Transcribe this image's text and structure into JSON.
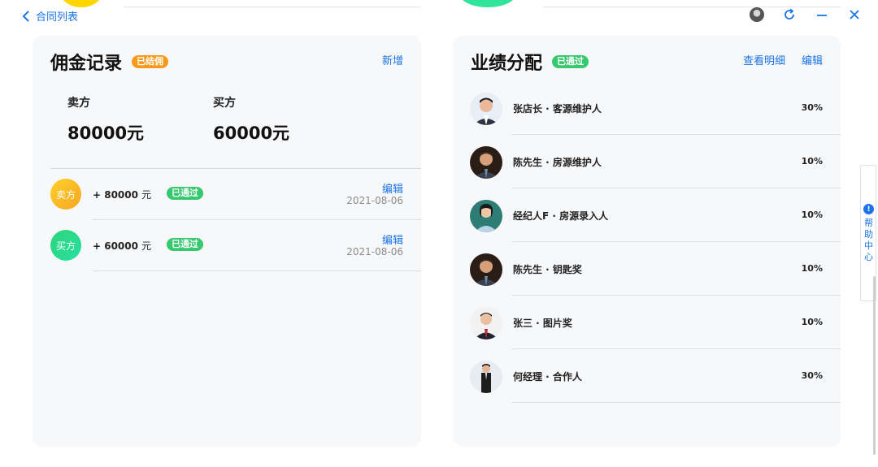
{
  "topbar": {
    "back_label": "合同列表"
  },
  "commission": {
    "title": "佣金记录",
    "status_badge": "已结佣",
    "add_label": "新增",
    "seller_label": "卖方",
    "seller_amount": "80000元",
    "buyer_label": "买方",
    "buyer_amount": "60000元",
    "records": [
      {
        "role": "卖方",
        "amount": "+ 80000",
        "unit": "元",
        "status": "已通过",
        "edit": "编辑",
        "date": "2021-08-06"
      },
      {
        "role": "买方",
        "amount": "+ 60000",
        "unit": "元",
        "status": "已通过",
        "edit": "编辑",
        "date": "2021-08-06"
      }
    ]
  },
  "performance": {
    "title": "业绩分配",
    "status_badge": "已通过",
    "detail_label": "查看明细",
    "edit_label": "编辑",
    "people": [
      {
        "name": "张店长 · 客源维护人",
        "percent": "30%"
      },
      {
        "name": "陈先生 · 房源维护人",
        "percent": "10%"
      },
      {
        "name": "经纪人F · 房源录入人",
        "percent": "10%"
      },
      {
        "name": "陈先生 · 钥匙奖",
        "percent": "10%"
      },
      {
        "name": "张三 · 图片奖",
        "percent": "10%"
      },
      {
        "name": "何经理 · 合作人",
        "percent": "30%"
      }
    ]
  },
  "help": {
    "icon": "!",
    "label": "帮助中心"
  },
  "colors": {
    "accent": "#1a73e8",
    "badge_orange": "#f79a1c",
    "badge_green": "#38c870"
  }
}
